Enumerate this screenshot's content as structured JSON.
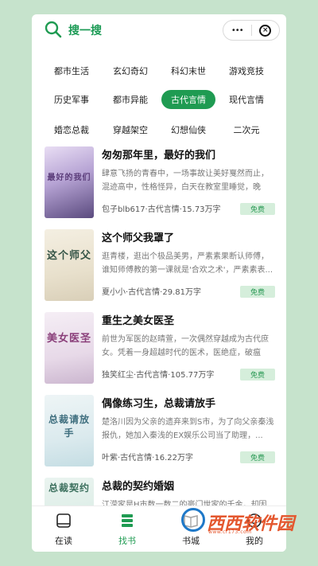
{
  "header": {
    "search_label": "搜一搜",
    "more_glyph": "•••",
    "close_glyph": "×"
  },
  "categories": [
    {
      "label": "都市生活",
      "active": false
    },
    {
      "label": "玄幻奇幻",
      "active": false
    },
    {
      "label": "科幻末世",
      "active": false
    },
    {
      "label": "游戏竞技",
      "active": false
    },
    {
      "label": "历史军事",
      "active": false
    },
    {
      "label": "都市异能",
      "active": false
    },
    {
      "label": "古代言情",
      "active": true
    },
    {
      "label": "现代言情",
      "active": false
    },
    {
      "label": "婚恋总裁",
      "active": false
    },
    {
      "label": "穿越架空",
      "active": false
    },
    {
      "label": "幻想仙侠",
      "active": false
    },
    {
      "label": "二次元",
      "active": false
    }
  ],
  "books": [
    {
      "title": "匆匆那年里，最好的我们",
      "desc": "肆意飞扬的青春中，一场事故让美好戛然而止，混迹高中，性格怪异，白天在教室里睡觉，晚上...",
      "meta": "包子blb617·古代言情·15.73万字",
      "badge": "免费",
      "cover_text": "最好的我们"
    },
    {
      "title": "这个师父我罩了",
      "desc": "逛青楼，逛出个极品美男，严素素果断认师傅，谁知师傅教的第一课就是'合欢之术'，严素素表...",
      "meta": "夏小小·古代言情·29.81万字",
      "badge": "免费",
      "cover_text": "这个师父"
    },
    {
      "title": "重生之美女医圣",
      "desc": "前世为军医的赵晴萱，一次偶然穿越成为古代庶女。凭着一身超越时代的医术，医绝症，破瘟疫...",
      "meta": "独笑红尘·古代言情·105.77万字",
      "badge": "免费",
      "cover_text": "美女医圣"
    },
    {
      "title": "偶像练习生，总裁请放手",
      "desc": "楚洛川因为父亲的遗弃来到S市，为了向父亲秦浅报仇，她加入秦浅的EX娱乐公司当了助理，...",
      "meta": "叶紫·古代言情·16.22万字",
      "badge": "免费",
      "cover_text": "总裁请放手"
    },
    {
      "title": "总裁的契约婚姻",
      "desc": "江滢家是H市数一数二的豪门世家的千金，却因一...",
      "meta": "",
      "badge": "",
      "cover_text": "总裁契约"
    }
  ],
  "tabs": [
    {
      "label": "在读",
      "active": false
    },
    {
      "label": "找书",
      "active": true
    },
    {
      "label": "书城",
      "active": false
    },
    {
      "label": "我的",
      "active": false
    }
  ],
  "watermark": {
    "title": "西西软件园",
    "sub": "www.cr173.com"
  },
  "colors": {
    "accent": "#1f9b52",
    "background": "#c6e3cc",
    "badge_bg": "#d5eedb"
  }
}
